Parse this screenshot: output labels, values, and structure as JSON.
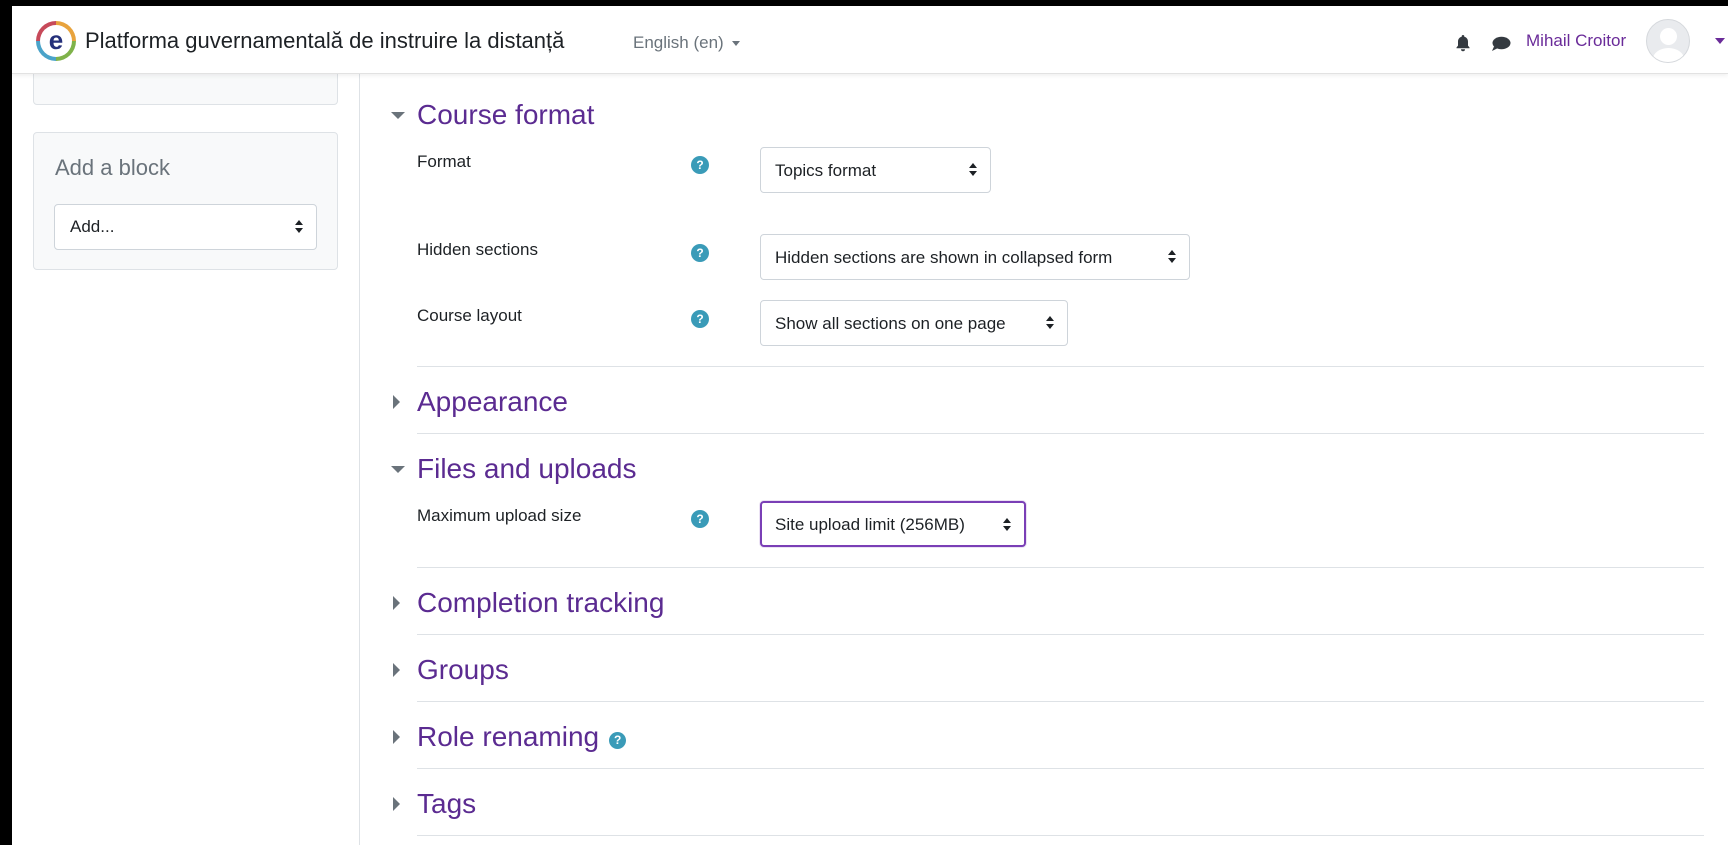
{
  "navbar": {
    "site_name": "Platforma guvernamentală de instruire la distanță",
    "logo_letter": "e",
    "language": "English (en)",
    "user_name": "Mihail Croitor",
    "icons": [
      "bell-icon",
      "chat-icon",
      "avatar",
      "chevron-down-icon"
    ]
  },
  "sidebar": {
    "add_block": {
      "title": "Add a block",
      "select_value": "Add..."
    }
  },
  "form": {
    "course_format": {
      "title": "Course format",
      "expanded": true,
      "fields": {
        "format": {
          "label": "Format",
          "value": "Topics format"
        },
        "hidden_sections": {
          "label": "Hidden sections",
          "value": "Hidden sections are shown in collapsed form"
        },
        "course_layout": {
          "label": "Course layout",
          "value": "Show all sections on one page"
        }
      }
    },
    "appearance": {
      "title": "Appearance",
      "expanded": false
    },
    "files_and_uploads": {
      "title": "Files and uploads",
      "expanded": true,
      "fields": {
        "max_upload_size": {
          "label": "Maximum upload size",
          "value": "Site upload limit (256MB)"
        }
      }
    },
    "completion_tracking": {
      "title": "Completion tracking",
      "expanded": false
    },
    "groups": {
      "title": "Groups",
      "expanded": false
    },
    "role_renaming": {
      "title": "Role renaming",
      "expanded": false
    },
    "tags": {
      "title": "Tags",
      "expanded": false
    }
  },
  "colors": {
    "accent": "#5b2b91",
    "help_icon": "#3a9bb8",
    "focus_border": "#7a3fb6"
  }
}
